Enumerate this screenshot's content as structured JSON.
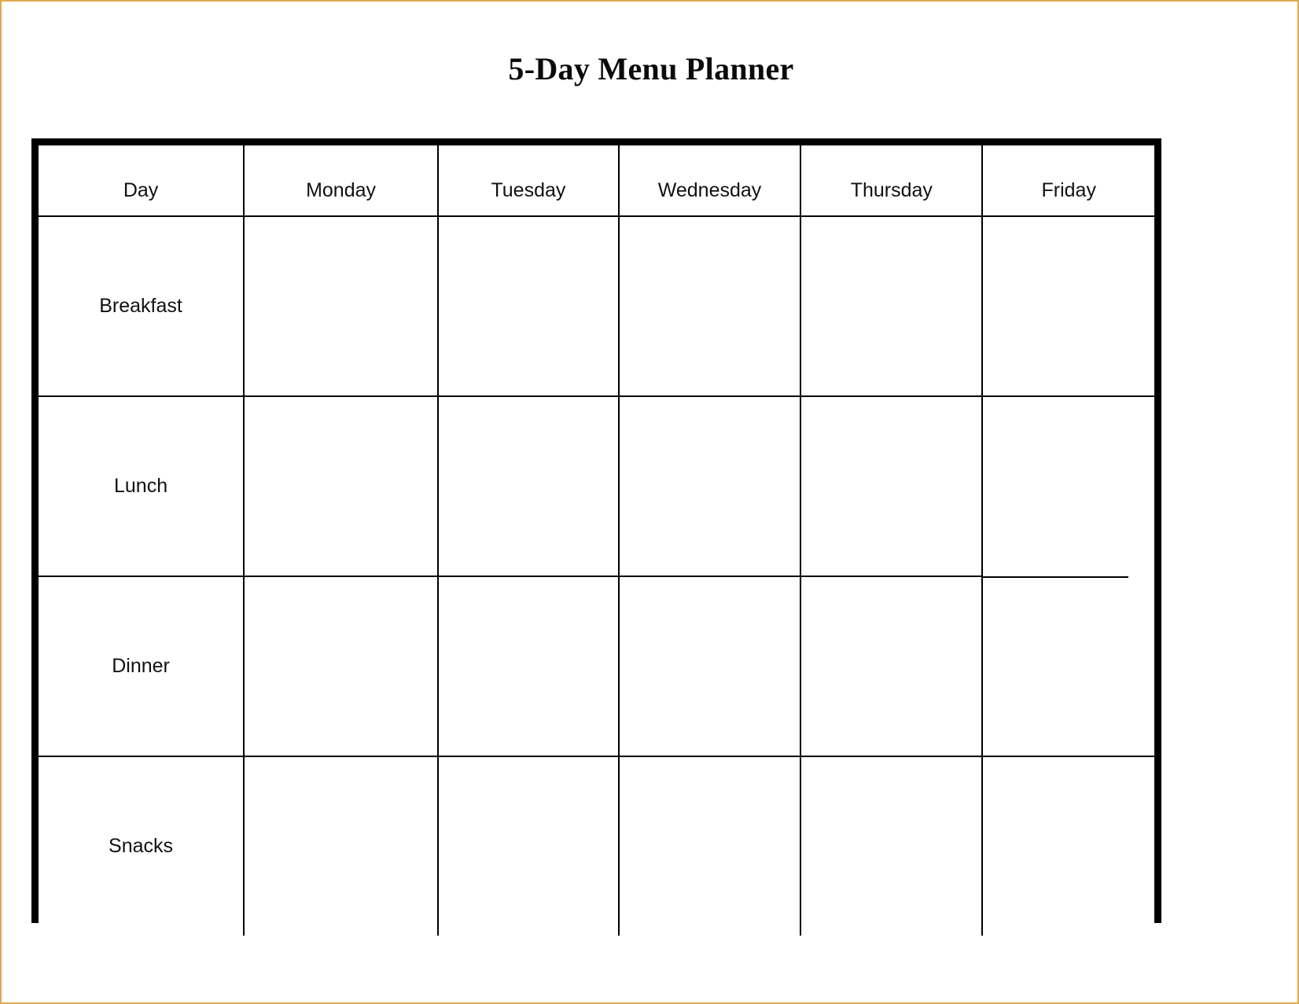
{
  "document": {
    "title": "5-Day Menu Planner",
    "page_border_color": "#e0a84e",
    "table_border_color": "#000000",
    "text_color": "#111111",
    "background_color": "#ffffff"
  },
  "table": {
    "headers": [
      {
        "label": "Day"
      },
      {
        "label": "Monday"
      },
      {
        "label": "Tuesday"
      },
      {
        "label": "Wednesday"
      },
      {
        "label": "Thursday"
      },
      {
        "label": "Friday"
      }
    ],
    "rows": [
      {
        "label": "Breakfast",
        "cells": [
          {
            "value": ""
          },
          {
            "value": ""
          },
          {
            "value": ""
          },
          {
            "value": ""
          },
          {
            "value": ""
          }
        ]
      },
      {
        "label": "Lunch",
        "cells": [
          {
            "value": ""
          },
          {
            "value": ""
          },
          {
            "value": ""
          },
          {
            "value": ""
          },
          {
            "value": ""
          }
        ]
      },
      {
        "label": "Dinner",
        "cells": [
          {
            "value": ""
          },
          {
            "value": ""
          },
          {
            "value": ""
          },
          {
            "value": ""
          },
          {
            "value": ""
          }
        ]
      },
      {
        "label": "Snacks",
        "cells": [
          {
            "value": ""
          },
          {
            "value": ""
          },
          {
            "value": ""
          },
          {
            "value": ""
          },
          {
            "value": ""
          }
        ]
      }
    ]
  }
}
